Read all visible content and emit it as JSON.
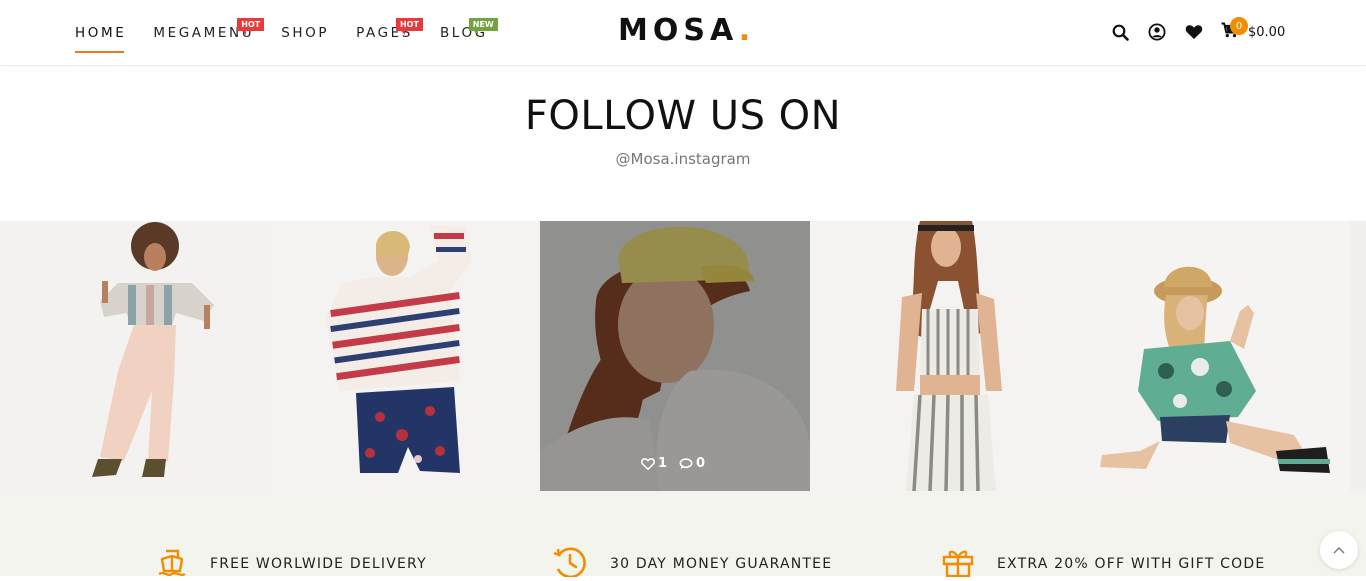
{
  "header": {
    "nav": [
      {
        "label": "HOME",
        "badge": ""
      },
      {
        "label": "MEGAMENU",
        "badge": "HOT"
      },
      {
        "label": "SHOP",
        "badge": ""
      },
      {
        "label": "PAGES",
        "badge": "HOT"
      },
      {
        "label": "BLOG",
        "badge": "NEW"
      }
    ],
    "logo": {
      "text": "MOSA",
      "dot": "."
    },
    "icons": [
      "search-icon",
      "user-icon",
      "heart-icon",
      "cart-icon"
    ],
    "cart": {
      "count": "0",
      "total": "$0.00"
    }
  },
  "follow": {
    "title": "FOLLOW US ON",
    "handle": "@Mosa.instagram"
  },
  "gallery": {
    "hover_stats": {
      "likes": "1",
      "comments": "0"
    }
  },
  "features": [
    {
      "icon": "ship-icon",
      "label": "FREE WORLWIDE DELIVERY"
    },
    {
      "icon": "clock-icon",
      "label": "30 DAY MONEY GUARANTEE"
    },
    {
      "icon": "gift-icon",
      "label": "EXTRA 20% OFF WITH GIFT CODE"
    }
  ],
  "colors": {
    "accent": "#f28c00",
    "hot": "#e53b3b",
    "new": "#73a33f",
    "features_bg": "#f4f4ee"
  }
}
